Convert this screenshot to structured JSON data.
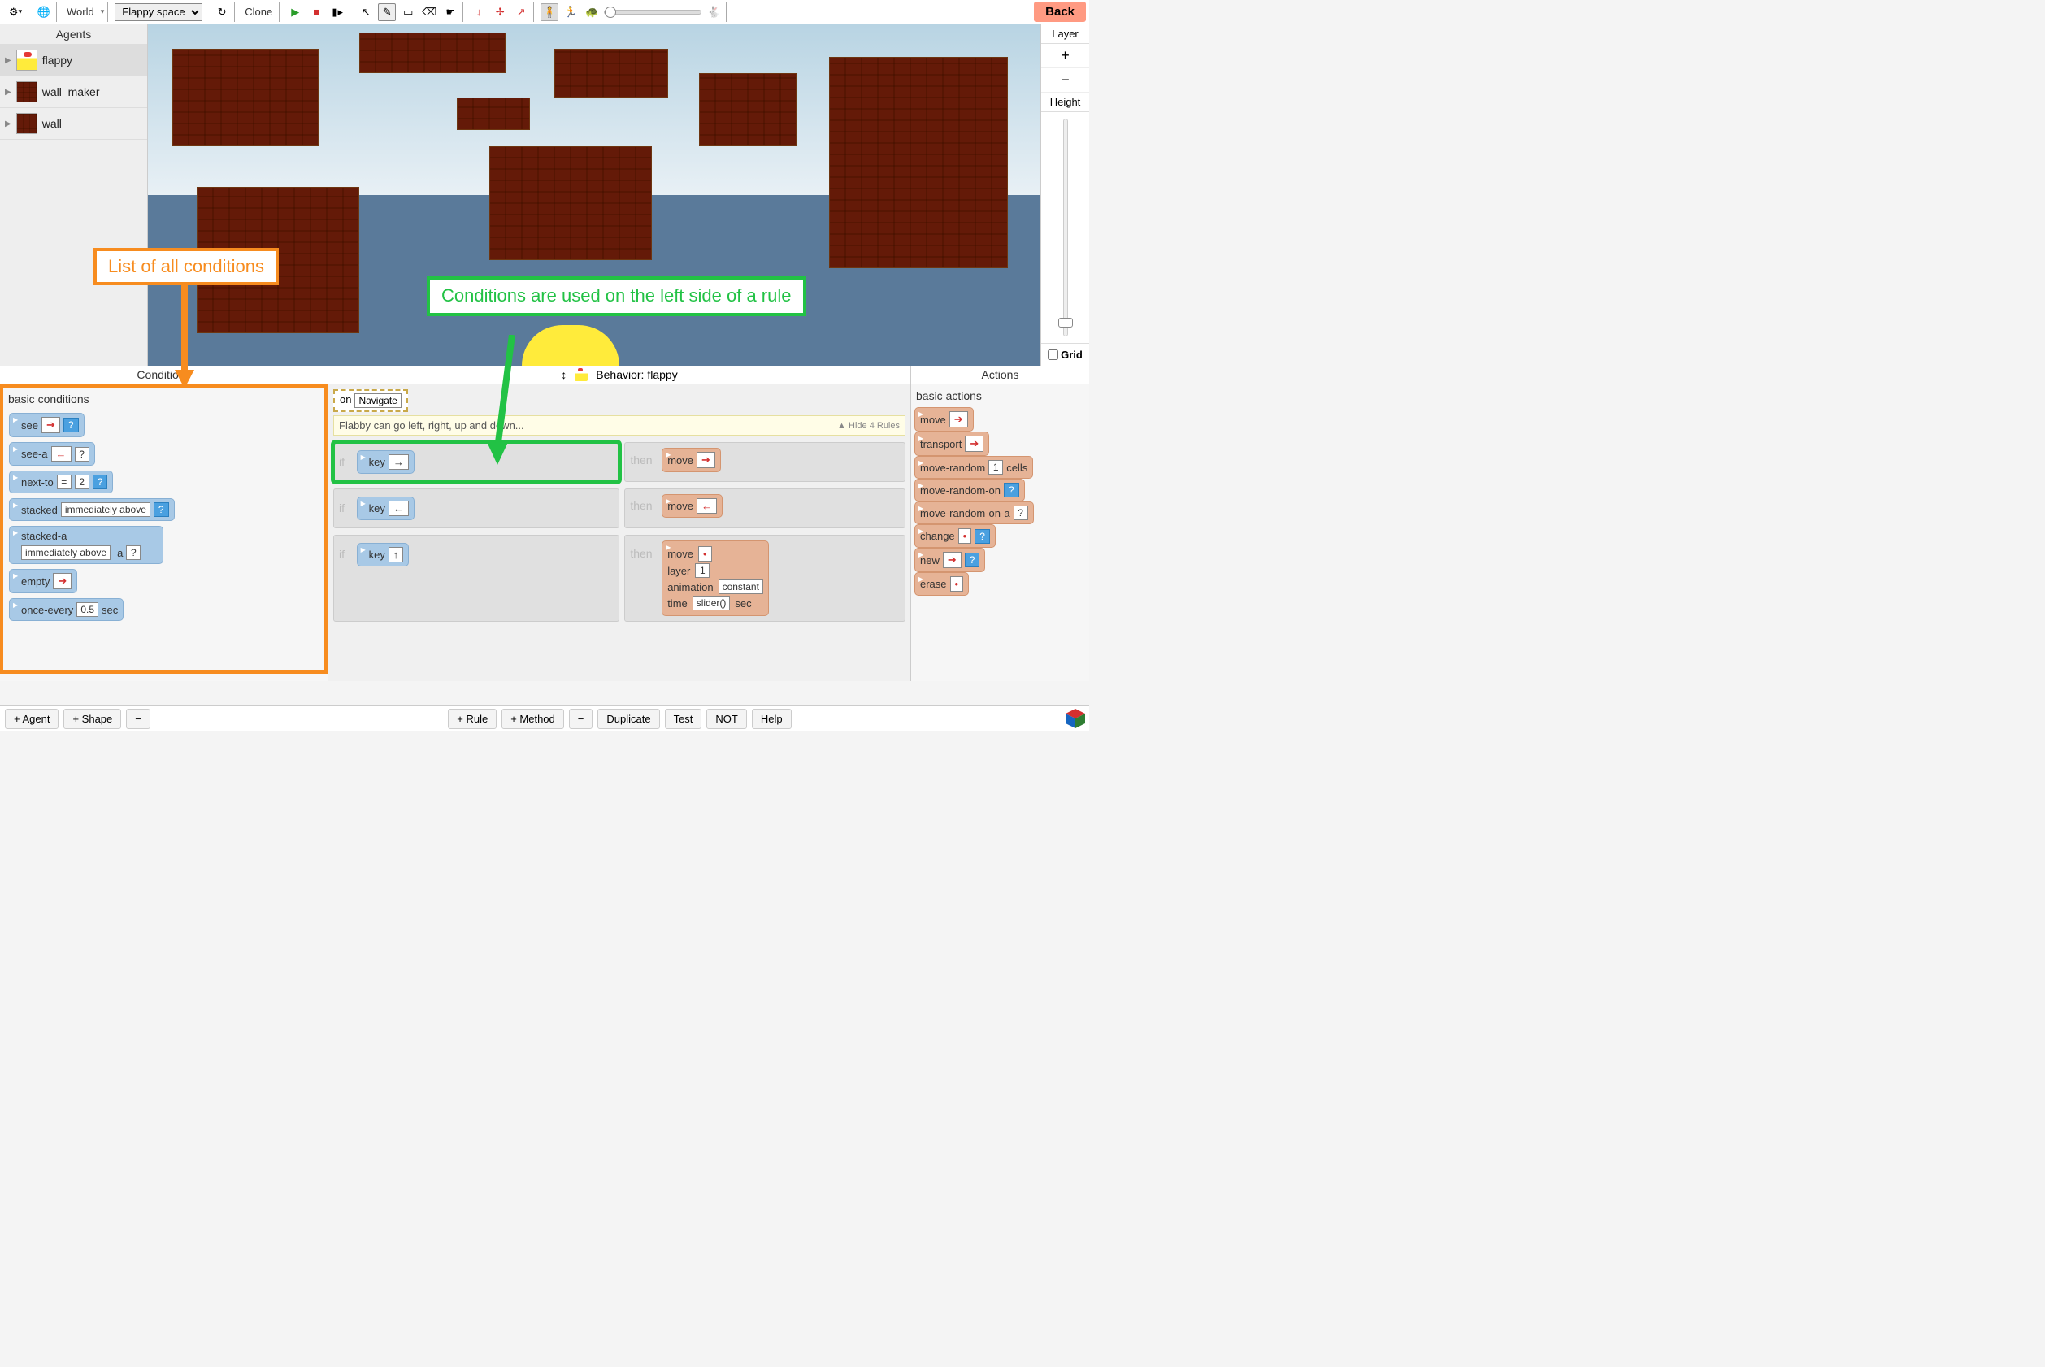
{
  "toolbar": {
    "world_label": "World",
    "project_select": "Flappy space",
    "clone": "Clone",
    "back": "Back"
  },
  "agents": {
    "header": "Agents",
    "items": [
      {
        "name": "flappy",
        "icon": "flappy",
        "selected": true
      },
      {
        "name": "wall_maker",
        "icon": "brick",
        "selected": false
      },
      {
        "name": "wall",
        "icon": "brick",
        "selected": false
      }
    ]
  },
  "right_rail": {
    "layer": "Layer",
    "plus": "+",
    "minus": "−",
    "height": "Height",
    "grid": "Grid"
  },
  "callouts": {
    "conditions_list": "List of all conditions",
    "rule_left": "Conditions are used on the left side of a rule"
  },
  "editor": {
    "conditions_header": "Conditions",
    "behavior_header": "Behavior: flappy",
    "actions_header": "Actions",
    "basic_conditions": "basic conditions",
    "basic_actions": "basic actions",
    "on_label": "on",
    "navigate": "Navigate",
    "desc": "Flabby can go left, right, up and down...",
    "hide_rules": "▲ Hide 4 Rules",
    "if": "if",
    "then": "then",
    "conditions": {
      "see": "see",
      "see_a": "see-a",
      "next_to": "next-to",
      "next_to_op": "=",
      "next_to_val": "2",
      "stacked": "stacked",
      "stacked_rel": "immediately above",
      "stacked_a": "stacked-a",
      "stacked_a_rel": "immediately above",
      "stacked_a_a": "a",
      "empty": "empty",
      "once_every": "once-every",
      "once_every_val": "0.5",
      "sec": "sec",
      "key": "key",
      "q": "?",
      "arr_left": "←",
      "arr_right": "→",
      "arr_up": "↑",
      "arr_dot": "•",
      "arr_rt_red": "➔"
    },
    "actions": {
      "move": "move",
      "transport": "transport",
      "move_random": "move-random",
      "move_random_val": "1",
      "cells": "cells",
      "move_random_on": "move-random-on",
      "move_random_on_a": "move-random-on-a",
      "change": "change",
      "new": "new",
      "erase": "erase",
      "layer": "layer",
      "layer_val": "1",
      "animation": "animation",
      "animation_val": "constant",
      "time": "time",
      "time_val": "slider()",
      "sec": "sec"
    }
  },
  "bottombar": {
    "add_agent": "+ Agent",
    "add_shape": "+ Shape",
    "minus": "−",
    "add_rule": "+ Rule",
    "add_method": "+ Method",
    "minus2": "−",
    "duplicate": "Duplicate",
    "test": "Test",
    "not": "NOT",
    "help": "Help"
  }
}
